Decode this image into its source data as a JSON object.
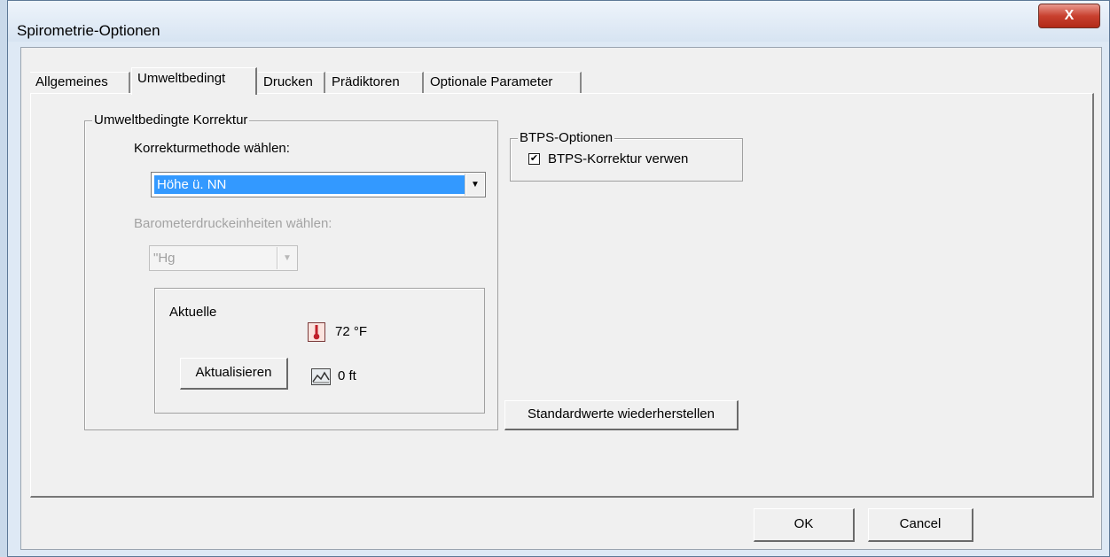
{
  "window": {
    "title": "Spirometrie-Optionen",
    "close_glyph": "X"
  },
  "tabs": [
    {
      "label": "Allgemeines"
    },
    {
      "label": "Umweltbedingt"
    },
    {
      "label": "Drucken"
    },
    {
      "label": "Prädiktoren"
    },
    {
      "label": "Optionale Parameter"
    }
  ],
  "env": {
    "group_title": "Umweltbedingte Korrektur",
    "method_label": "Korrekturmethode wählen:",
    "method_value": "Höhe ü. NN",
    "baro_label": "Barometerdruckeinheiten wählen:",
    "baro_value": "\"Hg",
    "current": {
      "title": "Aktuelle",
      "temperature": "72 °F",
      "altitude": "0 ft",
      "update_button": "Aktualisieren"
    }
  },
  "btps": {
    "group_title": "BTPS-Optionen",
    "checkbox_label": "BTPS-Korrektur verwen",
    "checked": true
  },
  "defaults_button": "Standardwerte wiederherstellen",
  "buttons": {
    "ok": "OK",
    "cancel": "Cancel"
  },
  "icons": {
    "thermometer": "thermometer-icon",
    "altitude": "mountain-icon",
    "dropdown": "chevron-down-icon"
  },
  "colors": {
    "selection": "#3399ff",
    "close_button": "#c8402f",
    "thermometer": "#c0202a"
  }
}
